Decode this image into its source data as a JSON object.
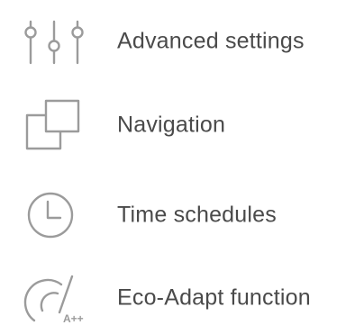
{
  "menu": {
    "items": [
      {
        "label": "Advanced settings",
        "icon": "sliders-icon"
      },
      {
        "label": "Navigation",
        "icon": "navigation-windows-icon"
      },
      {
        "label": "Time schedules",
        "icon": "clock-icon"
      },
      {
        "label": "Eco-Adapt function",
        "icon": "eco-gauge-icon",
        "icon_text": "A++"
      }
    ]
  },
  "colors": {
    "icon": "#9b9b9b",
    "label": "#4a4a4a",
    "background": "#ffffff"
  }
}
